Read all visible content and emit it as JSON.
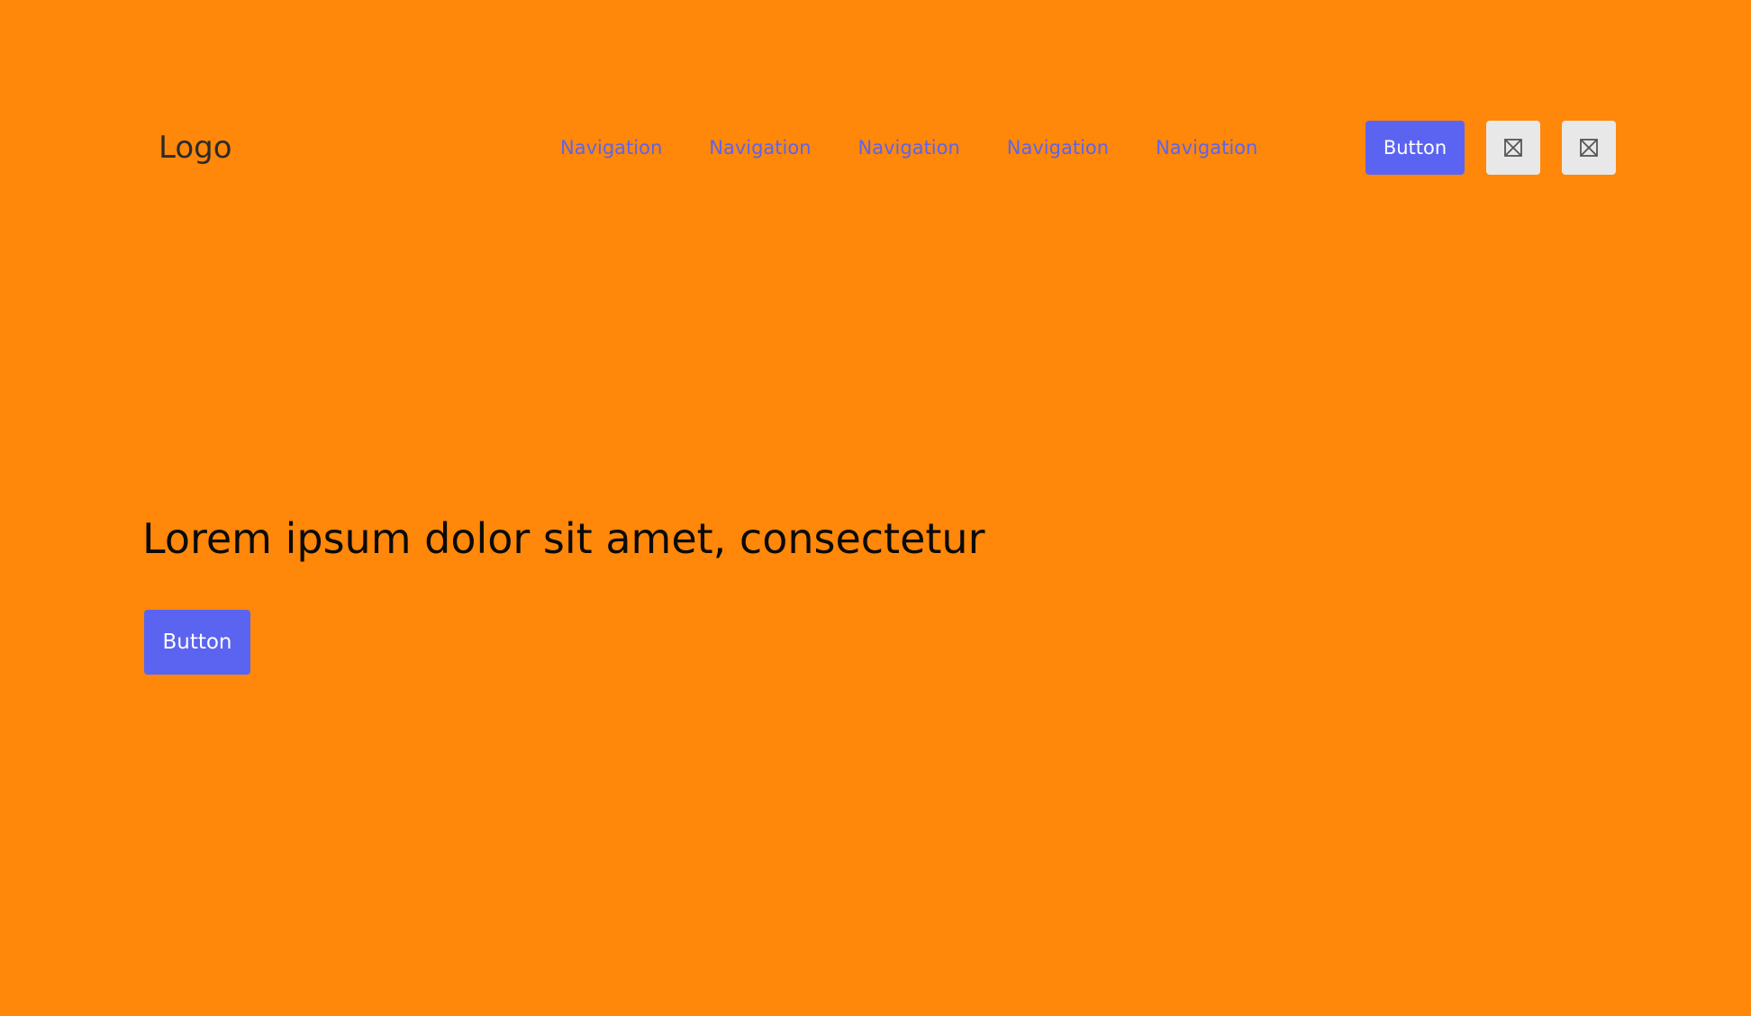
{
  "header": {
    "logo": "Logo",
    "nav_items": [
      "Navigation",
      "Navigation",
      "Navigation",
      "Navigation",
      "Navigation"
    ],
    "button_label": "Button",
    "icon_buttons": [
      "image-placeholder-icon",
      "image-placeholder-icon"
    ]
  },
  "hero": {
    "title": "Lorem ipsum dolor sit amet, consectetur",
    "button_label": "Button"
  },
  "colors": {
    "background": "#FF8709",
    "accent": "#5B64F0",
    "icon_button_bg": "#E8E8E8",
    "text_dark": "#0A0A0A"
  }
}
